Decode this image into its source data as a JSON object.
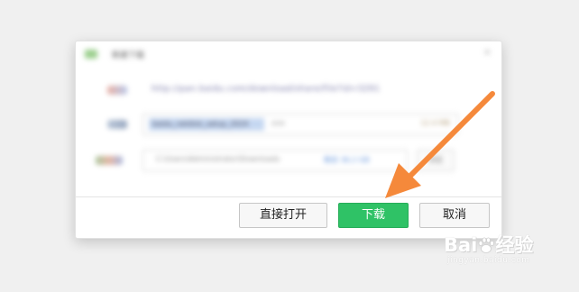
{
  "dialog": {
    "title": "新建下载",
    "url": "http://pan.baidu.com/download/share/file?id=3291",
    "file_name": "baidu_netdisk_setup_2024",
    "file_ext": ".exe",
    "file_size": "12.4 MB",
    "save_path": "C:\\Users\\Administrator\\Downloads",
    "free_space": "剩余 36.2 GB",
    "browse_label": "浏览"
  },
  "buttons": {
    "open_directly": "直接打开",
    "download": "下载",
    "cancel": "取消"
  },
  "watermark": {
    "brand": "Bai",
    "brand_tail": "经验",
    "site": "jingyan.baidu.com"
  },
  "colors": {
    "download_button": "#2fc266",
    "arrow": "#f5893b",
    "background": "#f0f0f0"
  },
  "icons": {
    "arrow": "annotation-arrow-icon",
    "baidu_paw": "baidu-paw-icon"
  }
}
